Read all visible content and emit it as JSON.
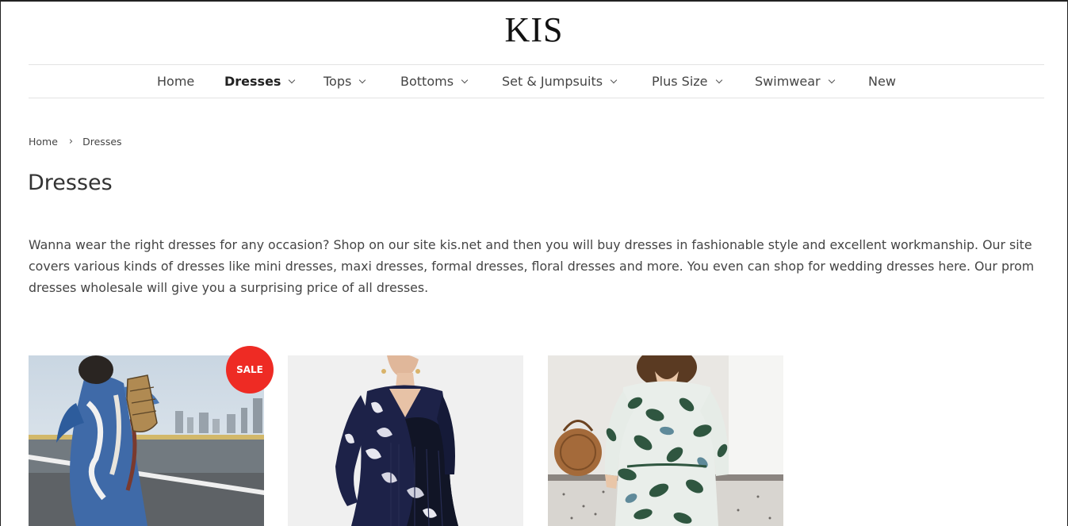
{
  "site": {
    "logo": "KIS"
  },
  "nav": {
    "items": [
      {
        "label": "Home",
        "has_dropdown": false,
        "active": false
      },
      {
        "label": "Dresses",
        "has_dropdown": true,
        "active": true
      },
      {
        "label": "Tops",
        "has_dropdown": true,
        "active": false
      },
      {
        "label": "Bottoms",
        "has_dropdown": true,
        "active": false
      },
      {
        "label": "Set & Jumpsuits",
        "has_dropdown": true,
        "active": false
      },
      {
        "label": "Plus Size",
        "has_dropdown": true,
        "active": false
      },
      {
        "label": "Swimwear",
        "has_dropdown": true,
        "active": false
      },
      {
        "label": "New",
        "has_dropdown": false,
        "active": false
      }
    ]
  },
  "breadcrumb": {
    "home": "Home",
    "separator": "›",
    "current": "Dresses"
  },
  "page": {
    "title": "Dresses",
    "description": "Wanna wear the right dresses for any occasion? Shop on our site kis.net and then you will buy dresses in fashionable style and excellent workmanship. Our site covers various kinds of dresses like mini dresses, maxi dresses, formal dresses, floral dresses and more. You even can shop for wedding dresses here. Our prom dresses wholesale will give you a surprising price of all dresses."
  },
  "products": [
    {
      "image": "blue-print-kaftan-dress-photo",
      "badge": "SALE"
    },
    {
      "image": "navy-floral-pleated-dress-photo",
      "badge": null
    },
    {
      "image": "green-floral-long-sleeve-dress-photo",
      "badge": null
    }
  ],
  "colors": {
    "sale_badge": "#ee2b24",
    "text": "#444444",
    "divider": "#e3e3e3"
  }
}
